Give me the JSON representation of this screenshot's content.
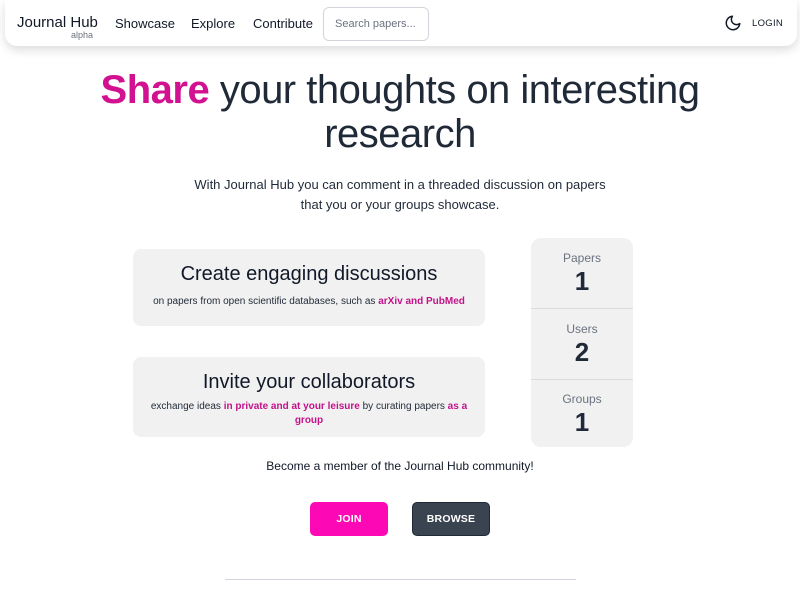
{
  "nav": {
    "brand": "Journal Hub",
    "brand_tag": "alpha",
    "links": [
      "Showcase",
      "Explore",
      "Contribute"
    ],
    "search_placeholder": "Search papers...",
    "theme_icon": "moon-icon",
    "login_label": "LOGIN"
  },
  "hero": {
    "accent": "Share",
    "headline_rest": " your thoughts on interesting research",
    "subtext": "With Journal Hub you can comment in a threaded discussion on papers that you or your groups showcase."
  },
  "features": [
    {
      "title": "Create engaging discussions",
      "text_1": "on papers from open scientific databases, such as ",
      "highlight_1": "arXiv and PubMed"
    },
    {
      "title": "Invite your collaborators",
      "text_1": "exchange ideas ",
      "highlight_1": "in private and at your leisure",
      "text_2": " by curating papers ",
      "highlight_2": "as a group"
    }
  ],
  "stats": [
    {
      "label": "Papers",
      "value": "1"
    },
    {
      "label": "Users",
      "value": "2"
    },
    {
      "label": "Groups",
      "value": "1"
    }
  ],
  "cta": {
    "text": "Become a member of the Journal Hub community!",
    "join_label": "JOIN",
    "browse_label": "BROWSE"
  },
  "colors": {
    "accent": "#d1118f",
    "join_button": "#fc08b4",
    "browse_button": "#3a4350",
    "card_background": "#f1f1f1"
  }
}
